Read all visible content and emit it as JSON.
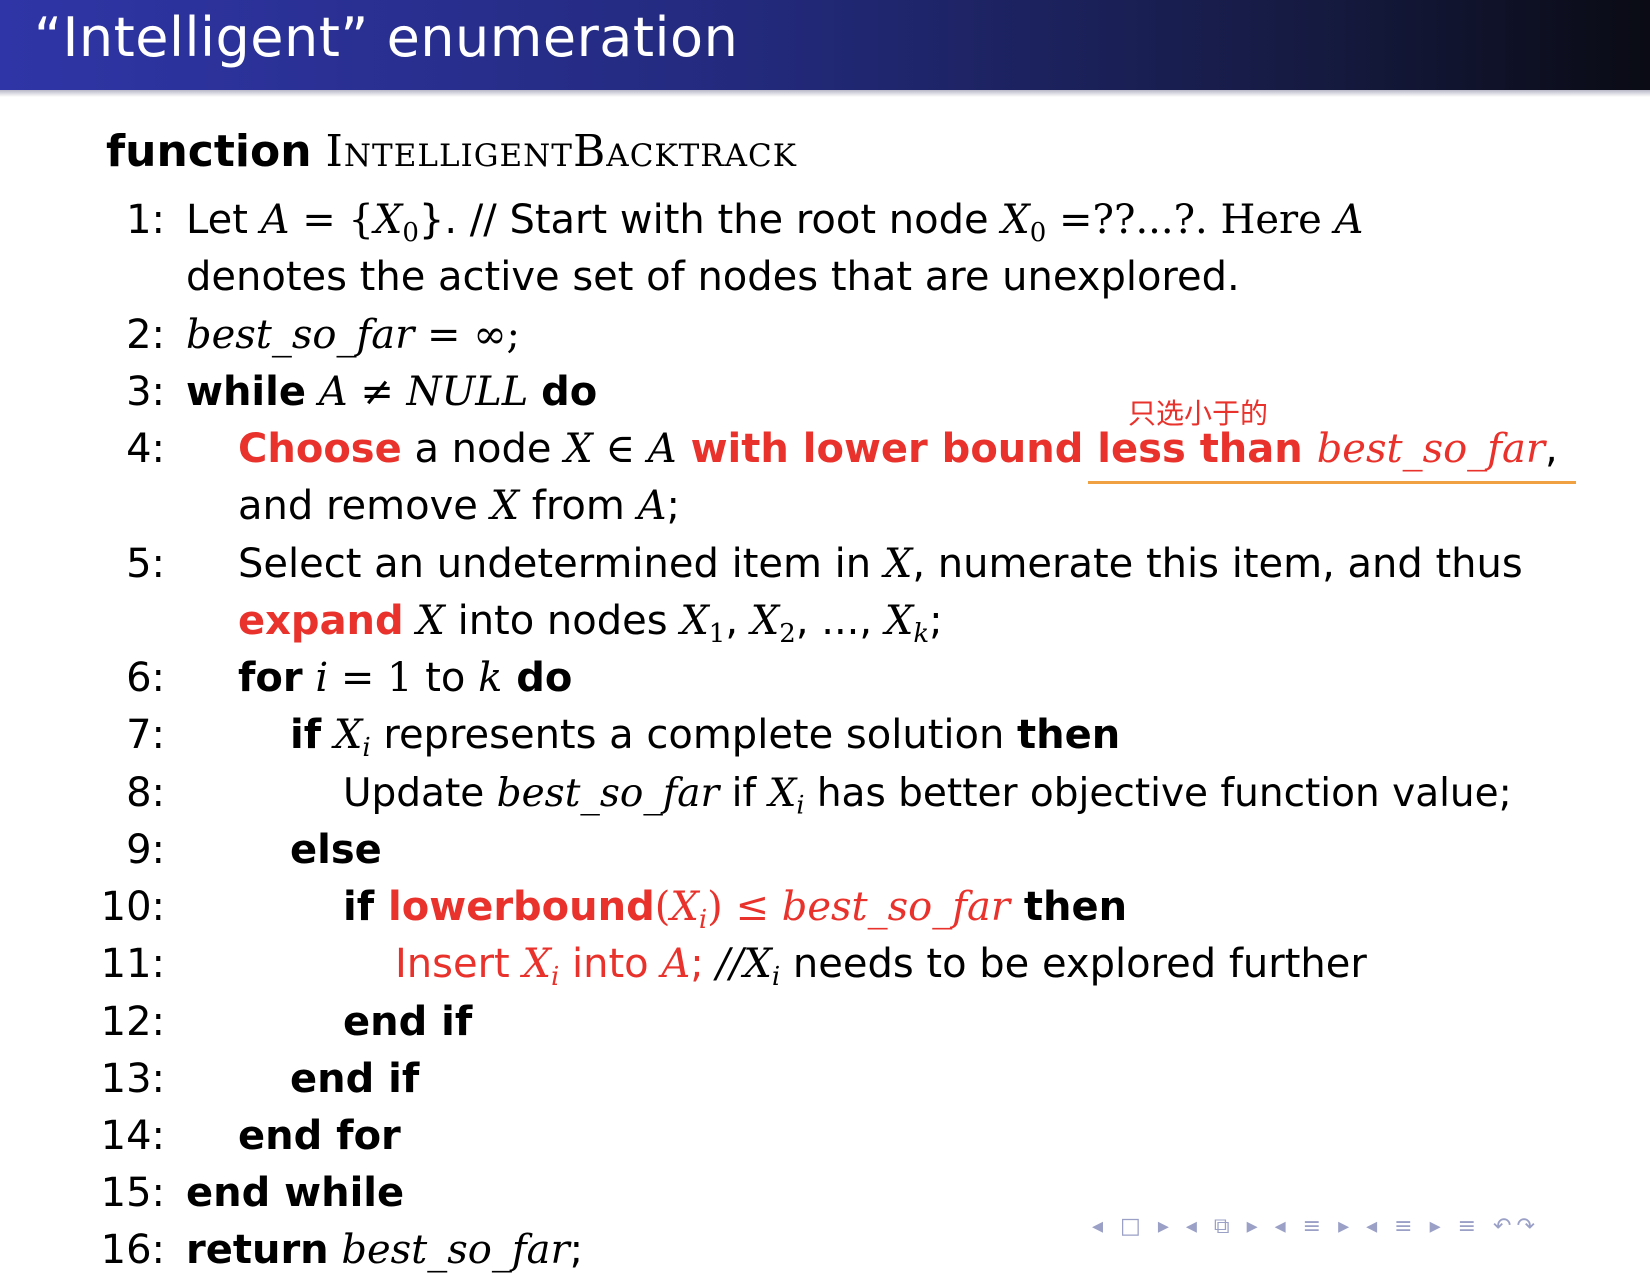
{
  "title": "“Intelligent” enumeration",
  "function": {
    "keyword": "function",
    "name": "IntelligentBacktrack"
  },
  "annotation": "只选小于的",
  "nav": {
    "symbols": "◂ □ ▸ ◂ ⧉ ▸ ◂ ≡ ▸ ◂ ≡ ▸   ≡   ↶↷"
  },
  "lines": {
    "l1": {
      "num": "1:",
      "a": "Let ",
      "b": "A",
      "c": " = {",
      "d": "X",
      "e": "0",
      "f": "}. // Start with the root node ",
      "g": "X",
      "h": "0",
      "i": " =??...?. Here ",
      "j": "A"
    },
    "l1b": {
      "a": "denotes the active set of nodes that are unexplored."
    },
    "l2": {
      "num": "2:",
      "a": "best_so_far",
      "b": " = ∞;"
    },
    "l3": {
      "num": "3:",
      "a": "while",
      "b": " A ≠ NULL ",
      "c": " do"
    },
    "l4": {
      "num": "4:",
      "a": "Choose",
      "b": " a node ",
      "c": "X",
      "d": " ∈ ",
      "e": "A",
      "f": " with lower bound less than ",
      "g": "best_so_far",
      "h": ","
    },
    "l4b": {
      "a": "and remove ",
      "b": "X",
      "c": " from ",
      "d": "A",
      "e": ";"
    },
    "l5": {
      "num": "5:",
      "a": "Select an undetermined item in ",
      "b": "X",
      "c": ", numerate this item, and thus"
    },
    "l5b": {
      "a": "expand",
      "b": " X",
      "c": " into nodes ",
      "d": "X",
      "e": "1",
      "f": ", ",
      "g": "X",
      "h": "2",
      "i": ", ..., ",
      "j": "X",
      "k": "k",
      "l": ";"
    },
    "l6": {
      "num": "6:",
      "a": "for",
      "b": " i",
      "c": " = 1",
      "d": " to ",
      "e": "k",
      "f": " do"
    },
    "l7": {
      "num": "7:",
      "a": "if",
      "b": " X",
      "c": "i",
      "d": " represents a complete solution ",
      "e": " then"
    },
    "l8": {
      "num": "8:",
      "a": "Update ",
      "b": "best_so_far",
      "c": " if ",
      "d": "X",
      "e": "i",
      "f": " has better objective function value;"
    },
    "l9": {
      "num": "9:",
      "a": "else"
    },
    "l10": {
      "num": "10:",
      "a": "if",
      "b": " lowerbound",
      "c": "(",
      "d": "X",
      "e": "i",
      "f": ") ≤ ",
      "g": "best_so_far",
      "h": " then"
    },
    "l11": {
      "num": "11:",
      "a": "Insert ",
      "b": "X",
      "c": "i",
      "d": " into ",
      "e": "A",
      "f": "; ",
      "g": "//X",
      "h": "i",
      "i": " needs to be explored further"
    },
    "l12": {
      "num": "12:",
      "a": "end if"
    },
    "l13": {
      "num": "13:",
      "a": "end if"
    },
    "l14": {
      "num": "14:",
      "a": "end for"
    },
    "l15": {
      "num": "15:",
      "a": "end while"
    },
    "l16": {
      "num": "16:",
      "a": "return",
      "b": " best_so_far",
      "c": ";"
    }
  }
}
